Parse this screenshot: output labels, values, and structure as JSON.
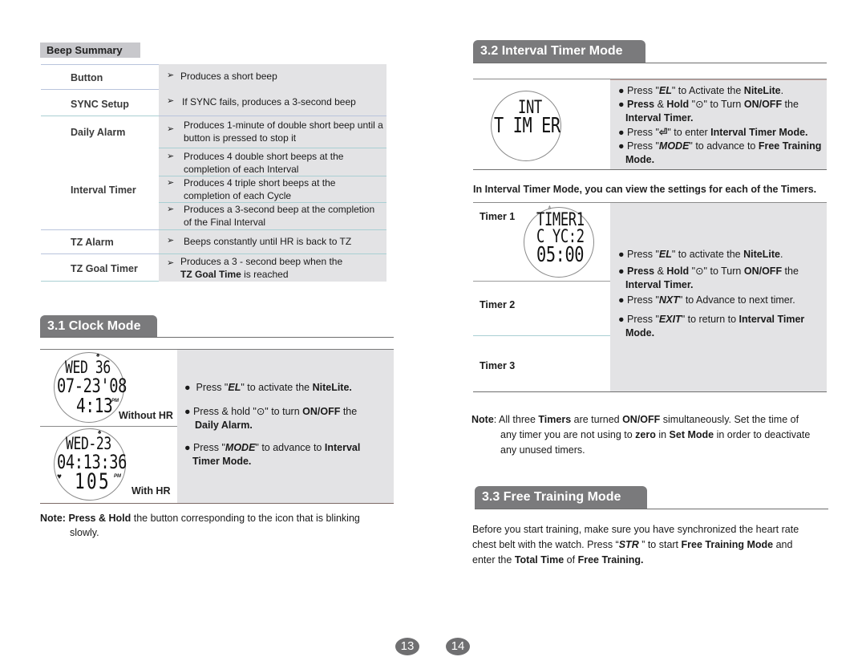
{
  "beep_summary": {
    "title": "Beep Summary",
    "rows": [
      {
        "label": "Button",
        "items": [
          "Produces a short beep"
        ]
      },
      {
        "label": "SYNC Setup",
        "items": [
          "If SYNC fails, produces a 3-second beep"
        ]
      },
      {
        "label": "Daily Alarm",
        "items": [
          "Produces 1-minute of double short beep until a button is pressed to stop it"
        ]
      },
      {
        "label": "Interval Timer",
        "items": [
          "Produces 4 double short beeps at the completion of each Interval",
          "Produces 4 triple short beeps at the completion of each Cycle",
          "Produces a 3-second beep at the completion of the Final Interval"
        ]
      },
      {
        "label": "TZ Alarm",
        "items": [
          "Beeps constantly until HR is back to TZ"
        ]
      },
      {
        "label": "TZ Goal Timer",
        "items": [
          "Produces a 3 - second beep when the",
          "TZ Goal Time",
          " is reached"
        ]
      }
    ],
    "arrow_glyph": "➢"
  },
  "clock_mode": {
    "title": "3.1 Clock Mode",
    "watch_without_hr": {
      "line1": "WED 36",
      "line2": "07-23'08",
      "line3": "4:13",
      "ampm": "PM",
      "caption": "Without HR"
    },
    "watch_with_hr": {
      "line1": "WED-23",
      "line2": "04:13:36",
      "line3": "105",
      "ampm": "PM",
      "caption": "With HR"
    },
    "bullets": [
      {
        "pre": "Press \"",
        "key": "EL",
        "mid": "\" to activate the ",
        "bold": "NiteLite",
        "post": "."
      },
      {
        "pre": "Press & hold \"",
        "icon": "⊙",
        "mid": "\" to turn ",
        "bold": "ON/OFF",
        "post": " the",
        "line2": "Daily Alarm."
      },
      {
        "pre": "Press \"",
        "key": "MODE",
        "mid": "\" to advance to ",
        "bold": "Interval",
        "line2": "Timer Mode."
      }
    ],
    "note_label": "Note:",
    "note_bold": "Press & Hold",
    "note_text": " the button corresponding to the icon that is  blinking",
    "note_line2": "slowly."
  },
  "interval_timer_mode": {
    "title": "3.2  Interval Timer Mode",
    "watch": {
      "line1": "INT",
      "line2": "T IM ER"
    },
    "bullets": [
      {
        "pre": "Press \"",
        "key": "EL",
        "mid": "\" to Activate the ",
        "bold": "NiteLite",
        "post": "."
      },
      {
        "bold_pre": "Press",
        "pre": " & ",
        "bold2": "Hold",
        "mid": " \"⊙\" to Turn ",
        "bold": "ON/OFF",
        "post": " the",
        "line2": "Interval Timer."
      },
      {
        "pre": "Press \"",
        "icon": "⏎",
        "mid": "\" to enter ",
        "bold": "Interval Timer Mode."
      },
      {
        "pre": "Press \"",
        "key": "MODE",
        "mid": "\" to advance to ",
        "bold": "Free Training",
        "line2": "Mode."
      }
    ],
    "intro": "In Interval Timer Mode, you can view the settings for each of the Timers.",
    "timers": [
      "Timer 1",
      "Timer 2",
      "Timer 3"
    ],
    "timer_watch": {
      "line1": "TIMER1",
      "line2": "C YC:2",
      "line3": "05:00"
    },
    "timer_bullets": [
      {
        "pre": "Press \"",
        "key": "EL",
        "mid": "\" to activate the ",
        "bold": "NiteLite",
        "post": "."
      },
      {
        "bold_pre": "Press",
        "pre": " & ",
        "bold2": "Hold",
        "mid": " \"⊙\" to Turn ",
        "bold": "ON/OFF",
        "post": " the",
        "line2": "Interval Timer."
      },
      {
        "pre": "Press \"",
        "key": "NXT",
        "mid": "\" to Advance to next timer."
      },
      {
        "pre": "Press \"",
        "key": "EXIT",
        "mid": "\" to return to ",
        "bold": "Interval Timer",
        "line2": "Mode."
      }
    ],
    "note_label": "Note",
    "note_lines": [
      ": All three <b>Timers</b> are turned <b>ON/OFF</b> simultaneously.  Set the time of",
      "any timer you are not using to <b>zero</b> in <b>Set Mode</b> in order to deactivate",
      "any unused timers."
    ]
  },
  "free_training_mode": {
    "title": "3.3 Free Training Mode",
    "paragraph_lines": [
      "Before you start training, make sure you have synchronized the heart rate",
      "chest belt with the watch.   Press “<b><i>STR</i></b> ” to start <b>Free Training Mode</b> and",
      "enter the <b>Total Time</b> of <b>Free Training.</b>"
    ]
  },
  "page_numbers": [
    "13",
    "14"
  ]
}
